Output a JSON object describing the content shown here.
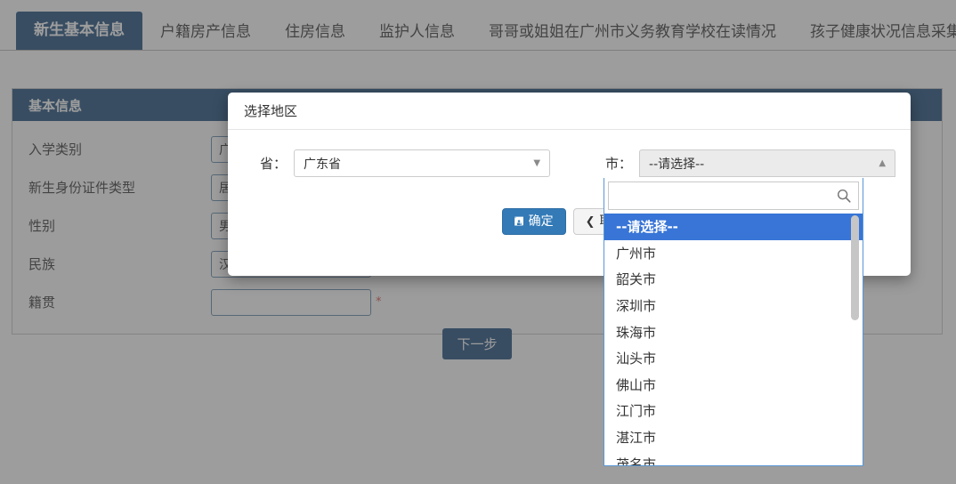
{
  "tabs": [
    {
      "label": "新生基本信息",
      "active": true
    },
    {
      "label": "户籍房产信息",
      "active": false
    },
    {
      "label": "住房信息",
      "active": false
    },
    {
      "label": "监护人信息",
      "active": false
    },
    {
      "label": "哥哥或姐姐在广州市义务教育学校在读情况",
      "active": false
    },
    {
      "label": "孩子健康状况信息采集",
      "active": false
    }
  ],
  "panel": {
    "title": "基本信息",
    "required_mark": "*",
    "fields": [
      {
        "label": "入学类别",
        "value": "广",
        "required": true
      },
      {
        "label": "新生身份证件类型",
        "value": "居",
        "required": true
      },
      {
        "label": "性别",
        "value": "男",
        "required": true
      },
      {
        "label": "民族",
        "value": "汉",
        "required": true
      },
      {
        "label": "籍贯",
        "value": "",
        "required": true
      }
    ],
    "next_button": "下一步"
  },
  "modal": {
    "title": "选择地区",
    "province": {
      "label": "省：",
      "value": "广东省",
      "caret_icon": "chevron-down-icon"
    },
    "city": {
      "label": "市：",
      "value": "--请选择--",
      "caret_icon": "chevron-up-icon"
    },
    "buttons": {
      "confirm": "确定",
      "confirm_icon": "save-icon",
      "cancel": "取消",
      "cancel_icon": "chevron-left-icon"
    }
  },
  "dropdown": {
    "search_value": "",
    "search_placeholder": "",
    "search_icon": "search-icon",
    "items": [
      {
        "label": "--请选择--",
        "selected": true
      },
      {
        "label": "广州市",
        "selected": false
      },
      {
        "label": "韶关市",
        "selected": false
      },
      {
        "label": "深圳市",
        "selected": false
      },
      {
        "label": "珠海市",
        "selected": false
      },
      {
        "label": "汕头市",
        "selected": false
      },
      {
        "label": "佛山市",
        "selected": false
      },
      {
        "label": "江门市",
        "selected": false
      },
      {
        "label": "湛江市",
        "selected": false
      },
      {
        "label": "茂名市",
        "selected": false
      }
    ]
  },
  "colors": {
    "brand_dark_blue": "#1b4a7a",
    "accent_blue": "#337ab7",
    "select_highlight": "#3875d7",
    "required_red": "#d9534f"
  }
}
